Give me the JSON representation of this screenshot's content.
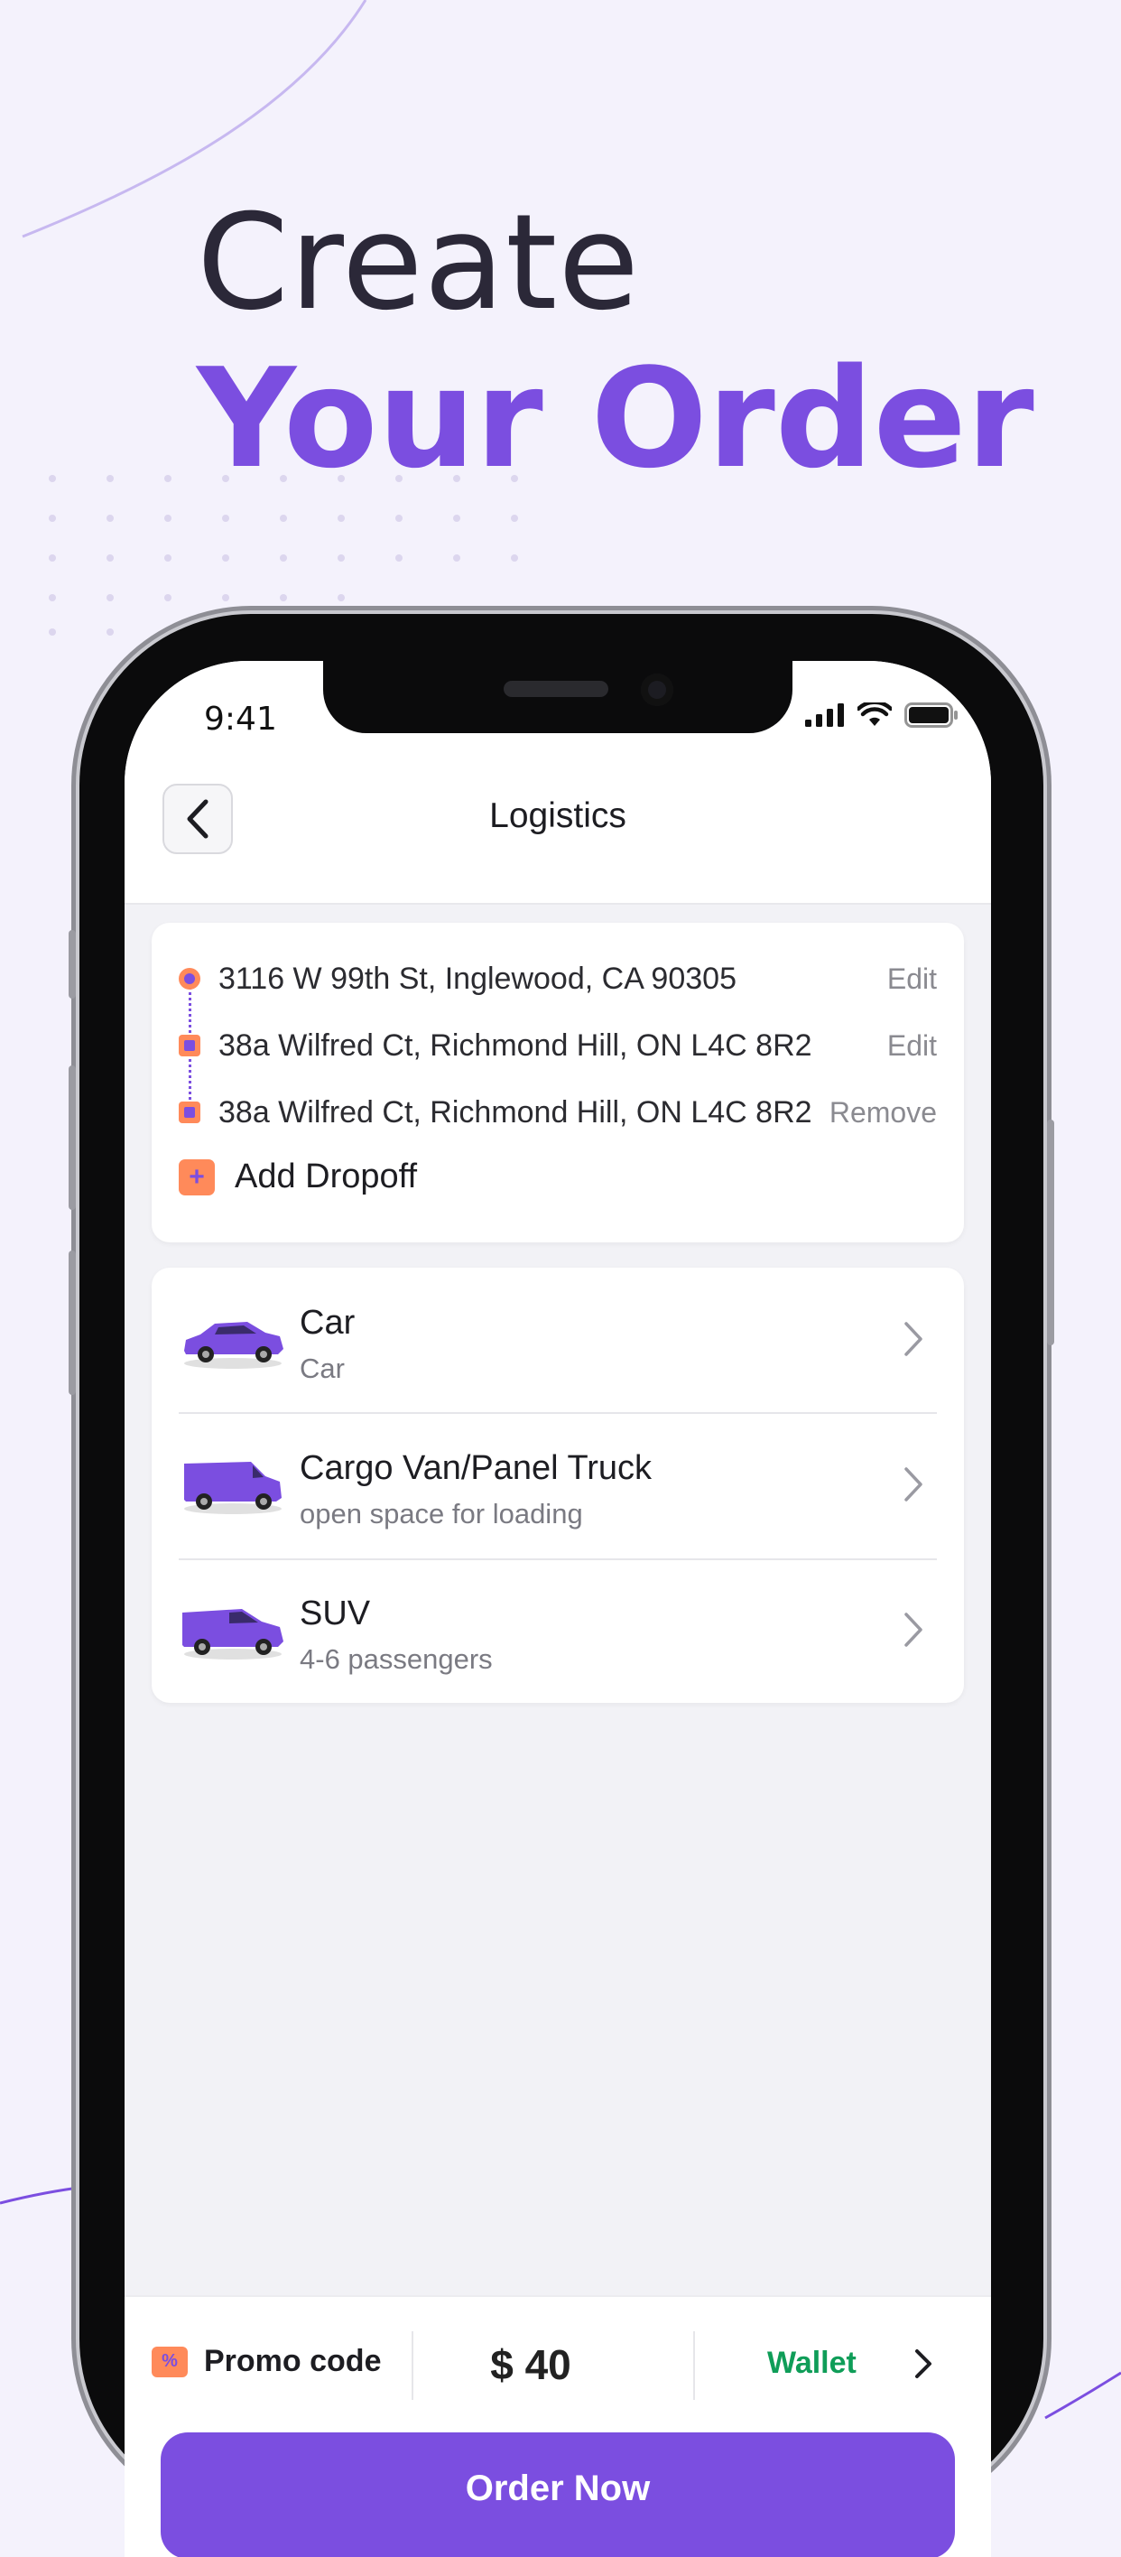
{
  "headline": {
    "line1": "Create",
    "line2": "Your Order"
  },
  "colors": {
    "accent": "#7b4ee0",
    "marker": "#ff8a5a",
    "wallet": "#0f9d58",
    "background": "#f4f2fc"
  },
  "status_bar": {
    "time": "9:41",
    "icons": [
      "signal-icon",
      "wifi-icon",
      "battery-icon"
    ]
  },
  "nav": {
    "title": "Logistics",
    "back_icon": "chevron-left-icon"
  },
  "route": {
    "stops": [
      {
        "address": "3116 W 99th St, Inglewood, CA 90305",
        "action": "Edit",
        "marker": "circle"
      },
      {
        "address": "38a Wilfred Ct, Richmond Hill, ON L4C 8R2",
        "action": "Edit",
        "marker": "square"
      },
      {
        "address": "38a Wilfred Ct, Richmond Hill, ON L4C 8R2",
        "action": "Remove",
        "marker": "square"
      }
    ],
    "add_label": "Add Dropoff"
  },
  "vehicles": [
    {
      "name": "Car",
      "subtitle": "Car",
      "icon": "car-icon"
    },
    {
      "name": "Cargo Van/Panel Truck",
      "subtitle": "open space for loading",
      "icon": "van-icon"
    },
    {
      "name": "SUV",
      "subtitle": "4-6 passengers",
      "icon": "suv-icon"
    }
  ],
  "footer": {
    "promo_label": "Promo code",
    "price": "$ 40",
    "wallet_label": "Wallet",
    "order_button": "Order Now"
  }
}
